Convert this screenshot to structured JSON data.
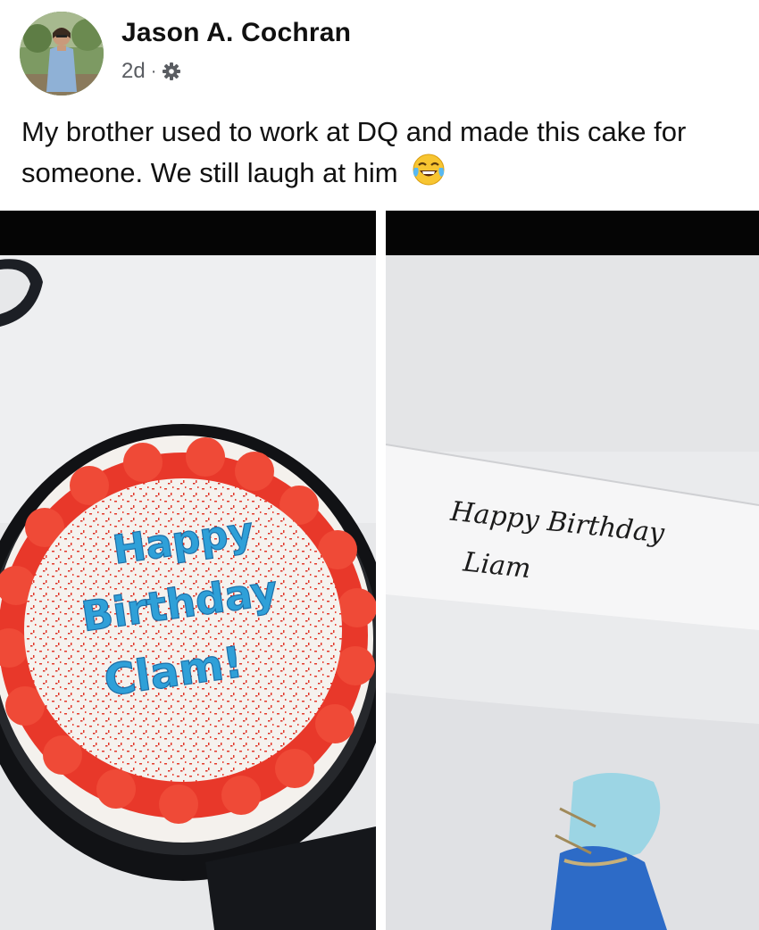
{
  "post": {
    "author": "Jason A. Cochran",
    "time": "2d",
    "separator": "·",
    "privacy_icon": "gear-icon",
    "text": "My brother used to work at DQ and made this cake for someone. We still laugh at him",
    "emoji": "tears-of-joy-emoji"
  },
  "photos": {
    "left": {
      "cake_lines": [
        "Happy",
        "Birthday",
        "Clam!"
      ]
    },
    "right": {
      "note_lines": [
        "Happy Birthday",
        "Liam"
      ]
    }
  },
  "colors": {
    "frosting_red": "#e8382a",
    "writing_blue": "#2fa0d8",
    "table_white": "#e9eaec"
  }
}
